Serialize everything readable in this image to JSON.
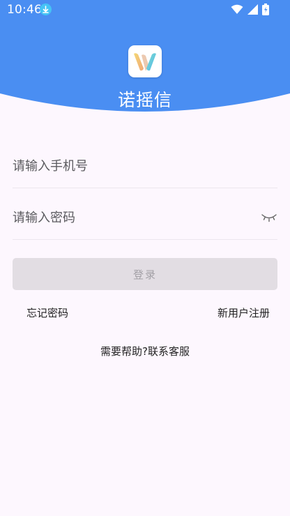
{
  "status_bar": {
    "time": "10:46",
    "icons": [
      "download-icon",
      "wifi-icon",
      "cell-signal-icon",
      "battery-charging-icon"
    ]
  },
  "header": {
    "app_name": "诺摇信",
    "logo_icon": "app-logo-w-icon",
    "background_color": "#4a8ef2"
  },
  "form": {
    "phone": {
      "placeholder": "请输入手机号",
      "value": ""
    },
    "password": {
      "placeholder": "请输入密码",
      "value": "",
      "toggle_icon": "eye-closed-icon"
    },
    "login_button_label": "登录",
    "forgot_password_label": "忘记密码",
    "register_label": "新用户注册",
    "help_label": "需要帮助?联系客服"
  },
  "colors": {
    "primary": "#4a8ef2",
    "background": "#fdf7fe",
    "button_disabled": "#e2dde3"
  }
}
